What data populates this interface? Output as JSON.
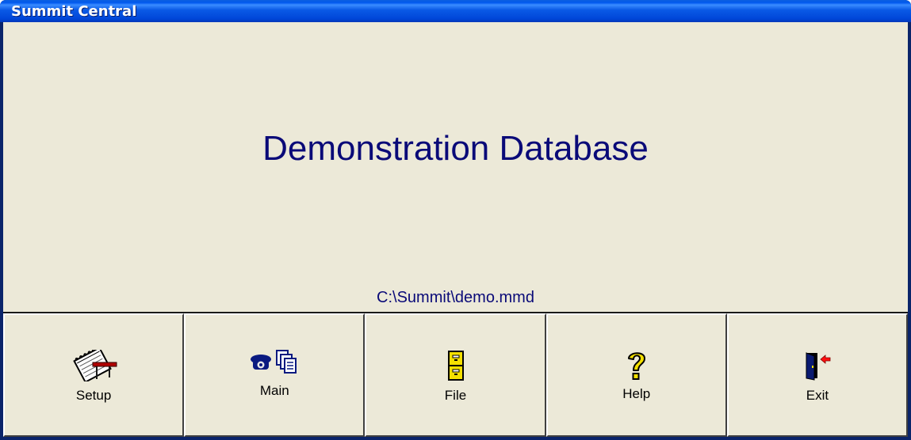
{
  "window": {
    "title": "Summit Central"
  },
  "main": {
    "database_name": "Demonstration Database",
    "database_path": "C:\\Summit\\demo.mmd"
  },
  "toolbar": {
    "buttons": [
      {
        "label": "Setup",
        "icon": "setup-notepad-icon"
      },
      {
        "label": "Main",
        "icon": "phone-documents-icon"
      },
      {
        "label": "File",
        "icon": "file-cabinet-icon"
      },
      {
        "label": "Help",
        "icon": "question-mark-icon"
      },
      {
        "label": "Exit",
        "icon": "exit-door-icon"
      }
    ]
  },
  "colors": {
    "titlebar": "#0058ee",
    "background": "#ece9d8",
    "text_accent": "#0a0a78"
  }
}
